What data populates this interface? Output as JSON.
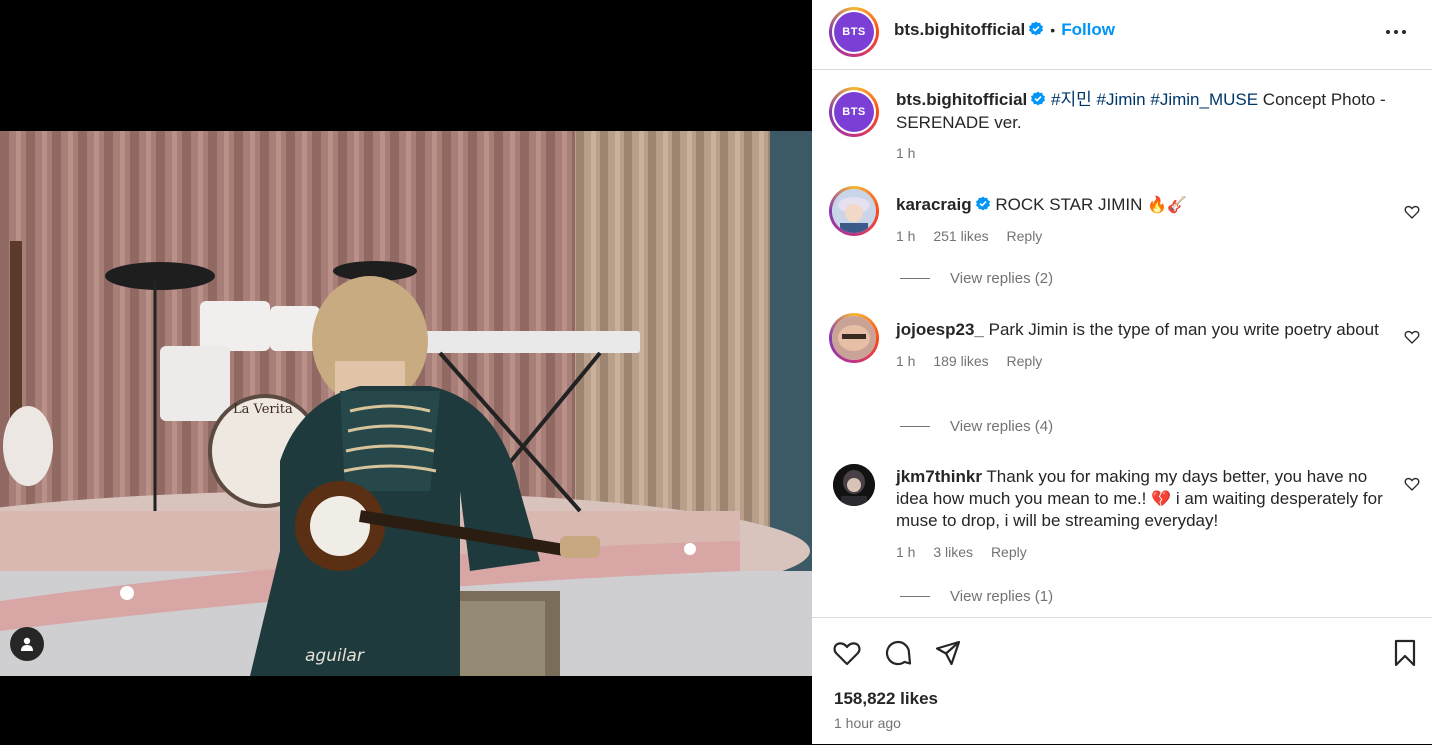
{
  "post": {
    "username": "bts.bighitofficial",
    "logo_text": "BTS",
    "follow_label": "Follow",
    "separator": "•",
    "caption": {
      "username": "bts.bighitofficial",
      "hashtag1": "#지민",
      "hashtag2": "#Jimin",
      "hashtag3": "#Jimin_MUSE",
      "text": "Concept Photo - SERENADE ver.",
      "time": "1 h"
    }
  },
  "comments": [
    {
      "username": "karacraig",
      "text": "ROCK STAR JIMIN",
      "emoji": "🔥🎸",
      "time": "1 h",
      "likes": "251 likes",
      "reply": "Reply",
      "view_replies": "View replies (2)"
    },
    {
      "username": "jojoesp23_",
      "text": "Park Jimin is the type of man you write poetry about",
      "time": "1 h",
      "likes": "189 likes",
      "reply": "Reply",
      "view_replies": "View replies (4)"
    },
    {
      "username": "jkm7thinkr",
      "text_before": "Thank you for making my days better, you have no idea how much you mean to me.!",
      "emoji": "💔",
      "text_after": "i am waiting desperately for muse to drop, i will be streaming everyday!",
      "time": "1 h",
      "likes": "3 likes",
      "reply": "Reply",
      "view_replies": "View replies (1)"
    }
  ],
  "footer": {
    "likes": "158,822 likes",
    "time_ago": "1 hour ago"
  },
  "icons": {
    "like": "heart-icon",
    "comment": "comment-icon",
    "share": "send-icon",
    "save": "bookmark-icon",
    "more": "more-icon",
    "verified": "verified-badge-icon",
    "user_tag": "user-tag-icon"
  },
  "colors": {
    "follow": "#0095f6",
    "verified": "#0095f6",
    "hashtag": "#00376b",
    "muted": "#737373"
  }
}
